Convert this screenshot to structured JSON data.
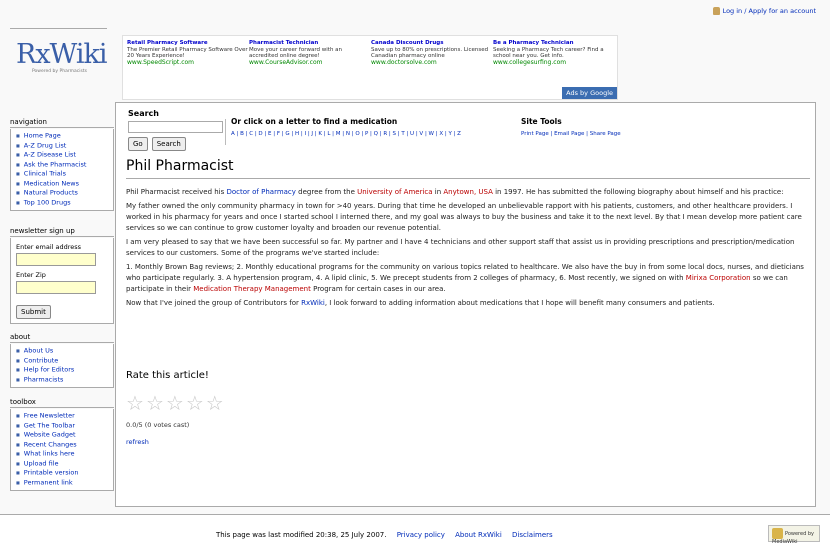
{
  "personal": {
    "login": "Log in / Apply for an account"
  },
  "logo": {
    "text": "RxWiki",
    "sub": "Powered by Pharmacists"
  },
  "ads": [
    {
      "title": "Retail Pharmacy Software",
      "text": "The Premier Retail Pharmacy Software Over 20 Years Experience!",
      "url": "www.SpeedScript.com"
    },
    {
      "title": "Pharmacist Technician",
      "text": "Move your career forward with an accredited online degree!",
      "url": "www.CourseAdvisor.com"
    },
    {
      "title": "Canada Discount Drugs",
      "text": "Save up to 80% on prescriptions. Licensed Canadian pharmacy online",
      "url": "www.doctorsolve.com"
    },
    {
      "title": "Be a Pharmacy Technician",
      "text": "Seeking a Pharmacy Tech career? Find a school near you. Get info.",
      "url": "www.collegesurfing.com"
    }
  ],
  "ads_by": "Ads by Google",
  "navigation": {
    "heading": "navigation",
    "items": [
      "Home Page",
      "A-Z Drug List",
      "A-Z Disease List",
      "Ask the Pharmacist",
      "Clinical Trials",
      "Medication News",
      "Natural Products",
      "Top 100 Drugs"
    ]
  },
  "newsletter": {
    "heading": "newsletter sign up",
    "email_label": "Enter email address",
    "zip_label": "Enter Zip",
    "submit": "Submit"
  },
  "about": {
    "heading": "about",
    "items": [
      "About Us",
      "Contribute",
      "Help for Editors",
      "Pharmacists"
    ]
  },
  "toolbox": {
    "heading": "toolbox",
    "items": [
      "Free Newsletter",
      "Get The Toolbar",
      "Website Gadget",
      "Recent Changes",
      "What links here",
      "Upload file",
      "Printable version",
      "Permanent link"
    ]
  },
  "search": {
    "label": "Search",
    "go": "Go",
    "search": "Search",
    "letters_heading": "Or click on a letter to find a medication",
    "letters": "A | B | C | D | E | F | G | H | I | J | K | L | M | N | O | P | Q | R | S | T | U | V | W | X | Y | Z",
    "tools_heading": "Site Tools",
    "tools": "Print Page | Email Page | Share Page"
  },
  "article": {
    "title": "Phil Pharmacist",
    "p1_a": "Phil Pharmacist received his ",
    "p1_link1": "Doctor of Pharmacy",
    "p1_b": " degree from the ",
    "p1_link2": "University of America",
    "p1_c": " in ",
    "p1_link3": "Anytown, USA",
    "p1_d": " in 1997. He has submitted the following biography about himself and his practice:",
    "p2": "My father owned the only community pharmacy in town for >40 years. During that time he developed an unbelievable rapport with his patients, customers, and other healthcare providers. I worked in his pharmacy for years and once I started school I interned there, and my goal was always to buy the business and take it to the next level. By that I mean develop more patient care services so we can continue to grow customer loyalty and broaden our revenue potential.",
    "p3": "I am very pleased to say that we have been successful so far. My partner and I have 4 technicians and other support staff that assist us in providing prescriptions and prescription/medication services to our customers. Some of the programs we've started include:",
    "p4_a": "1. Monthly Brown Bag reviews; 2. Monthly educational programs for the community on various topics related to healthcare. We also have the buy in from some local docs, nurses, and dieticians who participate regularly. 3. A hypertension program, 4. A lipid clinic, 5. We precept students from 2 colleges of pharmacy, 6. Most recently, we signed on with ",
    "p4_link1": "Mirixa Corporation",
    "p4_b": " so we can participate in their ",
    "p4_link2": "Medication Therapy Management",
    "p4_c": " Program for certain cases in our area.",
    "p5_a": "Now that I've joined the group of Contributors for ",
    "p5_link": "RxWiki",
    "p5_b": ", I look forward to adding information about medications that I hope will benefit many consumers and patients."
  },
  "rating": {
    "heading": "Rate this article!",
    "votes": "0.0/5 (0 votes cast)",
    "refresh": "refresh",
    "max": 5,
    "value": 0
  },
  "footer": {
    "modified": "This page was last modified 20:38, 25 July 2007.",
    "privacy": "Privacy policy",
    "about": "About RxWiki",
    "disclaimers": "Disclaimers",
    "badge": "Powered by MediaWiki"
  }
}
